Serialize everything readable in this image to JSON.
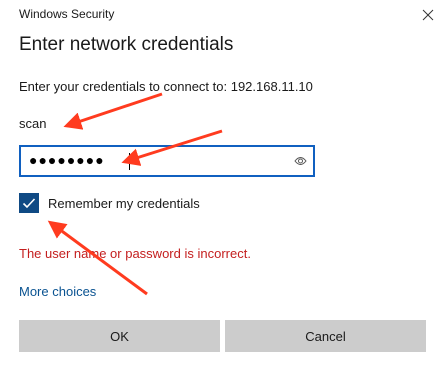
{
  "window": {
    "app_title": "Windows Security",
    "dialog_title": "Enter network credentials"
  },
  "prompt": {
    "connect_message": "Enter your credentials to connect to: 192.168.11.10"
  },
  "credentials": {
    "username": "scan",
    "password_masked": "●●●●●●●●"
  },
  "remember": {
    "label": "Remember my credentials",
    "checked": true
  },
  "error": {
    "message": "The user name or password is incorrect."
  },
  "links": {
    "more_choices": "More choices"
  },
  "buttons": {
    "ok_label": "OK",
    "cancel_label": "Cancel"
  },
  "colors": {
    "accent": "#1060c0",
    "checkbox": "#0f4a84",
    "error": "#c41e1e",
    "link": "#0a5391",
    "annotation_arrow": "#ff3b1f"
  }
}
